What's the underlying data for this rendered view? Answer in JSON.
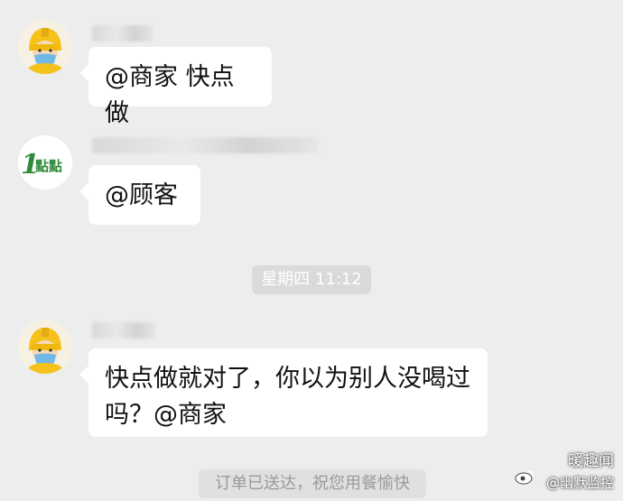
{
  "messages": [
    {
      "sender": "rider",
      "text": "@商家 快点做"
    },
    {
      "sender": "merchant",
      "text": "@顾客"
    },
    {
      "sender": "rider",
      "text": "快点做就对了，你以为别人没喝过吗？@商家"
    }
  ],
  "timestamp": "星期四 11:12",
  "system_message": "订单已送达，祝您用餐愉快",
  "merchant_logo_text": "1點點",
  "watermark": {
    "line1": "暖趣闻",
    "line2": "@幽默监控"
  },
  "colors": {
    "background": "#ededed",
    "bubble": "#ffffff",
    "rider_yellow": "#f5c21b",
    "merchant_green": "#2f8a3a"
  },
  "icons": {
    "rider_avatar": "delivery-rider-helmet-mask",
    "merchant_avatar": "1diandian-logo"
  }
}
